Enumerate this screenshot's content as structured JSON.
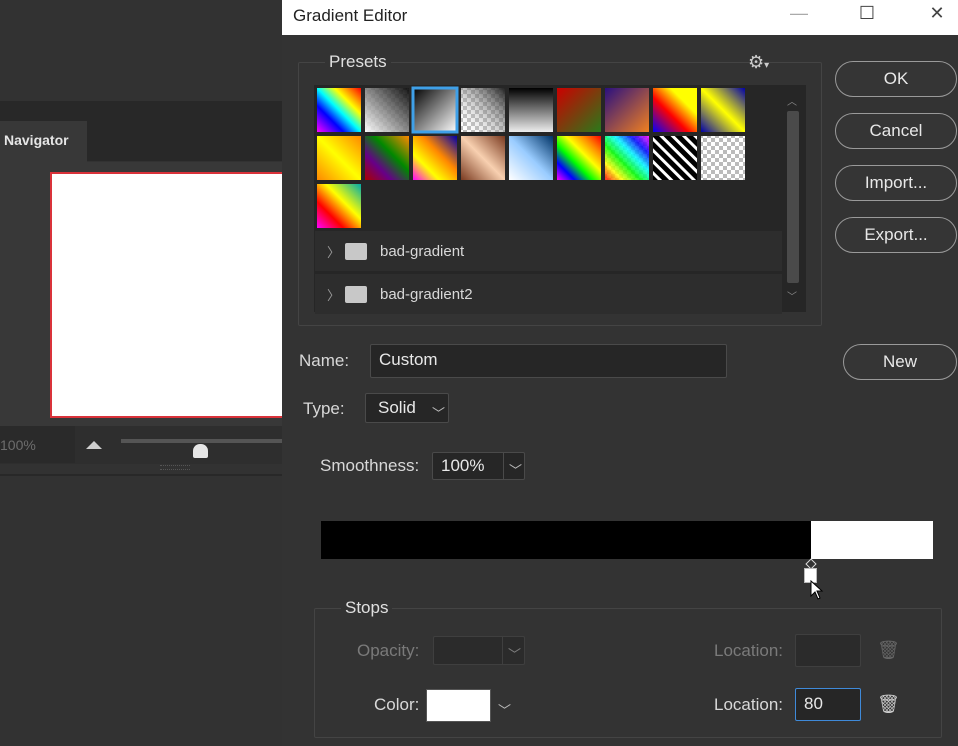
{
  "background_app": {
    "navigator_tab": "Navigator",
    "zoom_value": "100%"
  },
  "dialog": {
    "title": "Gradient Editor",
    "window_controls": {
      "minimize": "—",
      "maximize": "☐",
      "close": "✕"
    },
    "presets": {
      "label": "Presets",
      "gear_icon": "gear-icon",
      "folders": [
        {
          "name": "bad-gradient"
        },
        {
          "name": "bad-gradient2"
        }
      ]
    },
    "buttons": {
      "ok": "OK",
      "cancel": "Cancel",
      "import": "Import...",
      "export": "Export...",
      "new": "New"
    },
    "name": {
      "label": "Name:",
      "value": "Custom"
    },
    "type": {
      "label": "Type:",
      "value": "Solid"
    },
    "smoothness": {
      "label": "Smoothness:",
      "value": "100%"
    },
    "gradient": {
      "colors": [
        "#000000",
        "#ffffff"
      ],
      "stop_location": 80
    },
    "stops": {
      "label": "Stops",
      "opacity_label": "Opacity:",
      "opacity_value": "",
      "opacity_location_label": "Location:",
      "opacity_location_value": "",
      "color_label": "Color:",
      "color_value": "#ffffff",
      "color_location_label": "Location:",
      "color_location_value": "80"
    }
  },
  "colors": {
    "accent": "#3f8ad9",
    "dialog_bg": "#333333"
  }
}
